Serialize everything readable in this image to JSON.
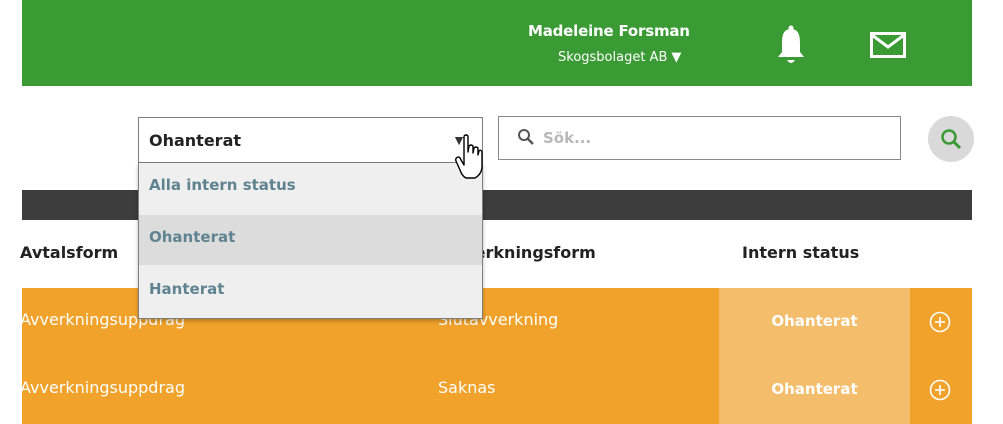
{
  "header": {
    "user_name": "Madeleine Forsman",
    "company": "Skogsbolaget AB",
    "company_caret": "▼",
    "bell_icon": "bell-icon",
    "mail_icon": "mail-icon"
  },
  "filter": {
    "status_select_value": "Ohanterat",
    "status_select_arrow": "▼",
    "options": [
      {
        "label": "Alla intern status",
        "selected": false
      },
      {
        "label": "Ohanterat",
        "selected": true
      },
      {
        "label": "Hanterat",
        "selected": false
      }
    ],
    "search_placeholder": "Sök...",
    "search_button_icon": "search-icon"
  },
  "table": {
    "headers": [
      "Avtalsform",
      "Avverkningsform",
      "Intern status"
    ],
    "rows": [
      {
        "avtalsform": "Avverkningsuppdrag",
        "avverkningsform": "Slutavverkning",
        "intern_status": "Ohanterat",
        "action_icon": "plus-circle-icon"
      },
      {
        "avtalsform": "Avverkningsuppdrag",
        "avverkningsform": "Saknas",
        "intern_status": "Ohanterat",
        "action_icon": "plus-circle-icon"
      }
    ]
  },
  "colors": {
    "header_bg": "#3a9a34",
    "row_bg": "#f1a22b",
    "status_bg": "#f4bd6b",
    "dark_band": "#3d3d3d",
    "option_text": "#5f8390"
  }
}
